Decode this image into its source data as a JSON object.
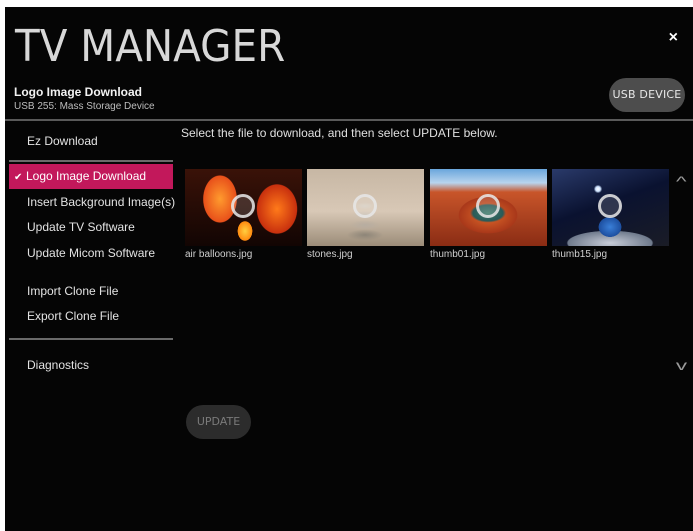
{
  "header": {
    "title": "TV MANAGER",
    "close_symbol": "×",
    "page_name": "Logo Image Download",
    "device": "USB 255: Mass Storage Device",
    "usb_button": "USB DEVICE"
  },
  "sidebar": {
    "items": [
      {
        "label": "Ez Download",
        "active": false
      },
      {
        "label": "Logo Image Download",
        "active": true
      },
      {
        "label": "Insert Background Image(s)",
        "active": false
      },
      {
        "label": "Update TV Software",
        "active": false
      },
      {
        "label": "Update Micom Software",
        "active": false
      },
      {
        "label": "Import Clone File",
        "active": false
      },
      {
        "label": "Export Clone File",
        "active": false
      },
      {
        "label": "Diagnostics",
        "active": false
      }
    ],
    "active_check": "✔"
  },
  "main": {
    "instruction": "Select the file to download, and then select UPDATE below.",
    "files": [
      {
        "name": "air balloons.jpg"
      },
      {
        "name": "stones.jpg"
      },
      {
        "name": "thumb01.jpg"
      },
      {
        "name": "thumb15.jpg"
      }
    ],
    "scroll_up_symbol": "^",
    "scroll_down_symbol": "v",
    "update_button": "UPDATE"
  },
  "colors": {
    "accent": "#c2185b",
    "background": "#050505"
  },
  "icons": [
    "close-icon",
    "check-icon",
    "chevron-up-icon",
    "chevron-down-icon"
  ]
}
